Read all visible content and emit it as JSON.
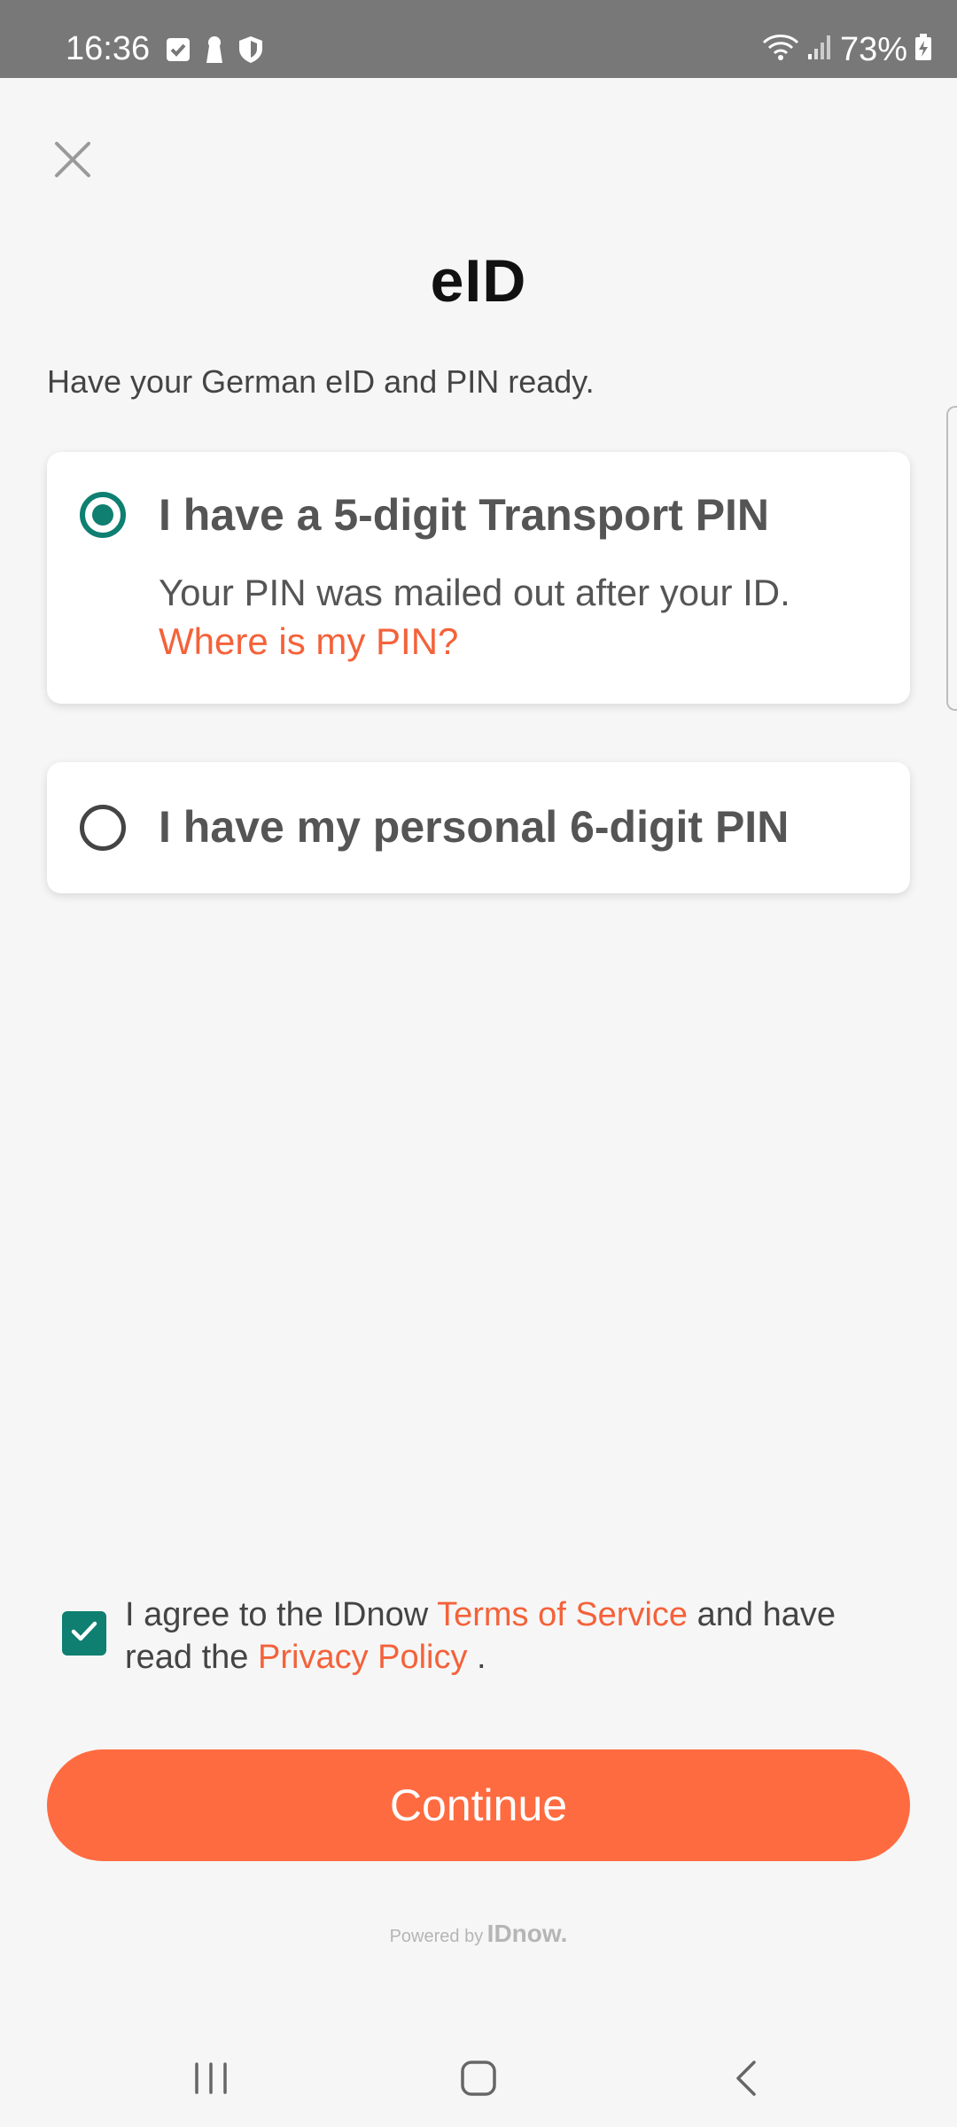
{
  "status_bar": {
    "time": "16:36",
    "battery": "73%",
    "icons": [
      "checkbox-notification-icon",
      "keyhole-icon",
      "shield-icon",
      "wifi-icon",
      "signal-icon",
      "battery-charging-icon"
    ]
  },
  "header": {
    "close_icon": "close-icon",
    "title": "eID"
  },
  "subtitle": "Have your German eID and PIN ready.",
  "options": [
    {
      "label": "I have a 5-digit Transport PIN",
      "description": "Your PIN was mailed out after your ID.",
      "link": "Where is my PIN?",
      "selected": true
    },
    {
      "label": "I have my personal 6-digit PIN",
      "selected": false
    }
  ],
  "consent": {
    "checked": true,
    "text_before": "I agree to the IDnow ",
    "terms_link": "Terms of Service",
    "text_middle": " and have read the ",
    "privacy_link": "Privacy Policy",
    "text_after": " ."
  },
  "continue_label": "Continue",
  "footer": {
    "powered_by": "Powered by",
    "brand": "IDnow."
  },
  "colors": {
    "accent": "#ff6b40",
    "link": "#f4623a",
    "teal": "#0e7f71",
    "background": "#f6f6f6"
  },
  "nav_bar": {
    "icons": [
      "recent-apps-icon",
      "home-icon",
      "back-icon"
    ]
  }
}
